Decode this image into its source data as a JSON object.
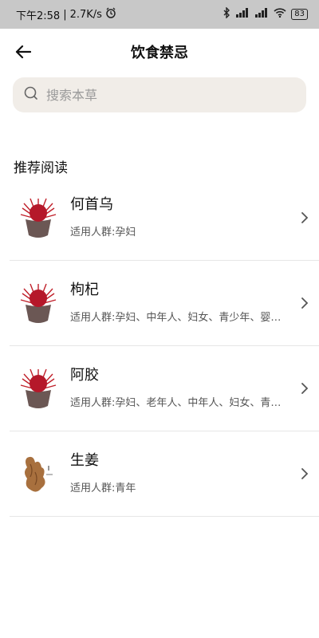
{
  "status_bar": {
    "time": "下午2:58",
    "speed": "2.7K/s",
    "battery": "83"
  },
  "header": {
    "title": "饮食禁忌"
  },
  "search": {
    "placeholder": "搜索本草"
  },
  "section": {
    "title": "推荐阅读"
  },
  "items": [
    {
      "name": "何首乌",
      "desc": "适用人群:孕妇",
      "thumb": "red-herb-pot"
    },
    {
      "name": "枸杞",
      "desc": "适用人群:孕妇、中年人、妇女、青少年、婴幼儿",
      "thumb": "red-herb-pot"
    },
    {
      "name": "阿胶",
      "desc": "适用人群:孕妇、老年人、中年人、妇女、青少年",
      "thumb": "red-herb-pot"
    },
    {
      "name": "生姜",
      "desc": "适用人群:青年",
      "thumb": "ginger-root"
    }
  ]
}
